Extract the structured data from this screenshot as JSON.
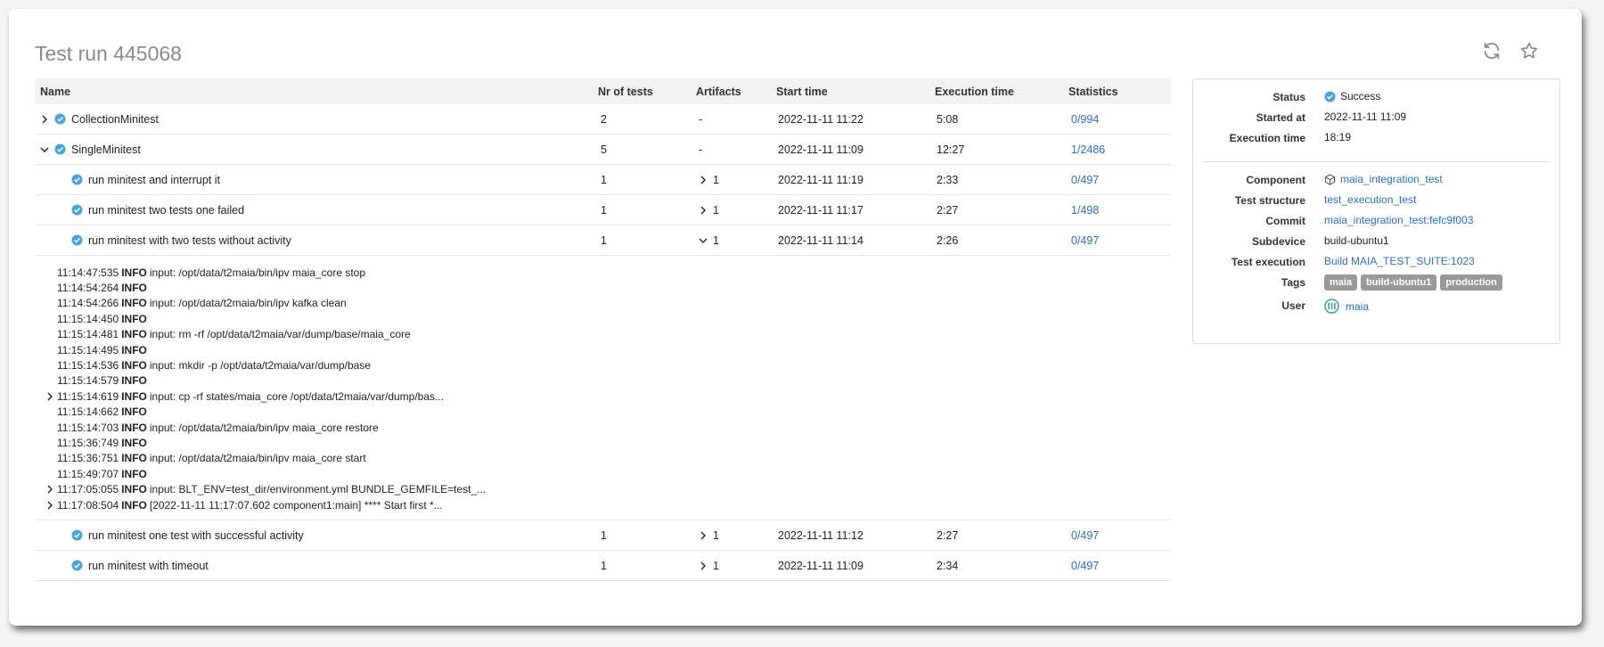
{
  "title": "Test run 445068",
  "toolbar": {
    "refresh_icon": "refresh-icon",
    "star_icon": "star-icon"
  },
  "colors": {
    "link": "#2a6ebb",
    "success": "#4aa3df",
    "tag": "#999999"
  },
  "table": {
    "headers": {
      "name": "Name",
      "nr": "Nr of tests",
      "artifacts": "Artifacts",
      "start": "Start time",
      "exec": "Execution time",
      "stats": "Statistics"
    },
    "rows": [
      {
        "name": "CollectionMinitest",
        "nr": "2",
        "artifacts": "-",
        "start": "2022-11-11 11:22",
        "exec": "5:08",
        "stats": "0/994"
      },
      {
        "name": "SingleMinitest",
        "nr": "5",
        "artifacts": "-",
        "start": "2022-11-11 11:09",
        "exec": "12:27",
        "stats": "1/2486"
      },
      {
        "name": "run minitest and interrupt it",
        "nr": "1",
        "artifacts": "1",
        "start": "2022-11-11 11:19",
        "exec": "2:33",
        "stats": "0/497"
      },
      {
        "name": "run minitest two tests one failed",
        "nr": "1",
        "artifacts": "1",
        "start": "2022-11-11 11:17",
        "exec": "2:27",
        "stats": "1/498"
      },
      {
        "name": "run minitest with two tests without activity",
        "nr": "1",
        "artifacts": "1",
        "start": "2022-11-11 11:14",
        "exec": "2:26",
        "stats": "0/497"
      },
      {
        "name": "run minitest one test with successful activity",
        "nr": "1",
        "artifacts": "1",
        "start": "2022-11-11 11:12",
        "exec": "2:27",
        "stats": "0/497"
      },
      {
        "name": "run minitest with timeout",
        "nr": "1",
        "artifacts": "1",
        "start": "2022-11-11 11:09",
        "exec": "2:34",
        "stats": "0/497"
      }
    ],
    "log": [
      {
        "time": "11:14:47:535",
        "level": "INFO",
        "msg": "input: /opt/data/t2maia/bin/ipv maia_core stop"
      },
      {
        "time": "11:14:54:264",
        "level": "INFO",
        "msg": ""
      },
      {
        "time": "11:14:54:266",
        "level": "INFO",
        "msg": "input: /opt/data/t2maia/bin/ipv kafka clean"
      },
      {
        "time": "11:15:14:450",
        "level": "INFO",
        "msg": ""
      },
      {
        "time": "11:15:14:481",
        "level": "INFO",
        "msg": "input: rm -rf /opt/data/t2maia/var/dump/base/maia_core"
      },
      {
        "time": "11:15:14:495",
        "level": "INFO",
        "msg": ""
      },
      {
        "time": "11:15:14:536",
        "level": "INFO",
        "msg": "input: mkdir -p /opt/data/t2maia/var/dump/base"
      },
      {
        "time": "11:15:14:579",
        "level": "INFO",
        "msg": ""
      },
      {
        "time": "11:15:14:619",
        "level": "INFO",
        "msg": "input: cp -rf states/maia_core /opt/data/t2maia/var/dump/bas..."
      },
      {
        "time": "11:15:14:662",
        "level": "INFO",
        "msg": ""
      },
      {
        "time": "11:15:14:703",
        "level": "INFO",
        "msg": "input: /opt/data/t2maia/bin/ipv maia_core restore"
      },
      {
        "time": "11:15:36:749",
        "level": "INFO",
        "msg": ""
      },
      {
        "time": "11:15:36:751",
        "level": "INFO",
        "msg": "input: /opt/data/t2maia/bin/ipv maia_core start"
      },
      {
        "time": "11:15:49:707",
        "level": "INFO",
        "msg": ""
      },
      {
        "time": "11:17:05:055",
        "level": "INFO",
        "msg": "input: BLT_ENV=test_dir/environment.yml BUNDLE_GEMFILE=test_..."
      },
      {
        "time": "11:17:08:504",
        "level": "INFO",
        "msg": "[2022-11-11 11:17:07.602 component1:main] **** Start first *..."
      }
    ]
  },
  "panel": {
    "status_label": "Status",
    "status_value": "Success",
    "started_label": "Started at",
    "started_value": "2022-11-11 11:09",
    "exec_label": "Execution time",
    "exec_value": "18:19",
    "component_label": "Component",
    "component_value": "maia_integration_test",
    "structure_label": "Test structure",
    "structure_value": "test_execution_test",
    "commit_label": "Commit",
    "commit_value": "maia_integration_test:fefc9f003",
    "subdevice_label": "Subdevice",
    "subdevice_value": "build-ubuntu1",
    "testexec_label": "Test execution",
    "testexec_value": "Build MAIA_TEST_SUITE:1023",
    "tags_label": "Tags",
    "tags": [
      "maia",
      "build-ubuntu1",
      "production"
    ],
    "user_label": "User",
    "user_value": "maia"
  }
}
